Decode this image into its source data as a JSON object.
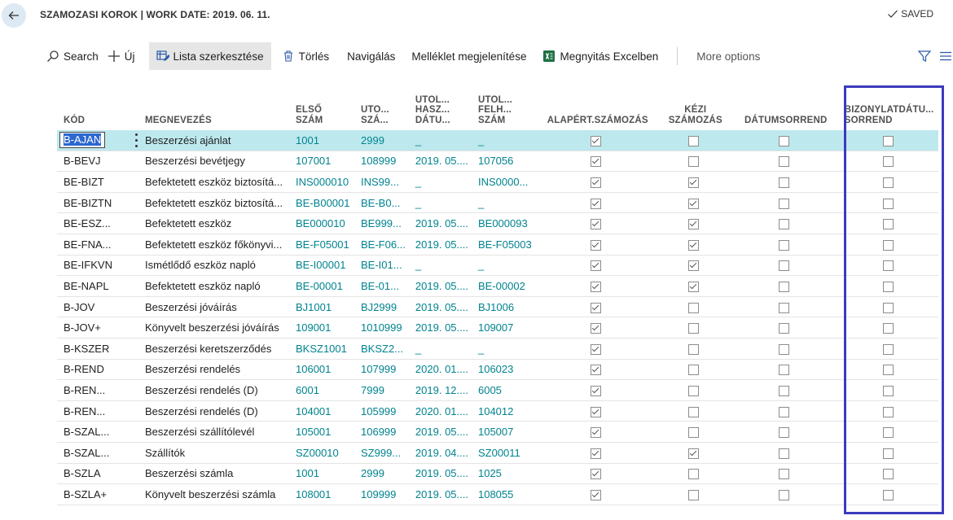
{
  "header": {
    "title": "SZAMOZASI KOROK | WORK DATE: 2019. 06. 11.",
    "saved_label": "SAVED"
  },
  "toolbar": {
    "search": "Search",
    "new": "Új",
    "edit_list": "Lista szerkesztése",
    "delete": "Törlés",
    "navigate": "Navigálás",
    "attachments": "Melléklet megjelenítése",
    "open_excel": "Megnyitás Excelben",
    "more_options": "More options"
  },
  "columns": [
    "KÓD",
    "MEGNEVEZÉS",
    "ELSŐ\nSZÁM",
    "UTO...\nSZÁ...",
    "UTOL...\nHASZ...\nDÁTU...",
    "UTOL...\nFELH...\nSZÁM",
    "ALAPÉRT.SZÁMOZÁS",
    "KÉZI\nSZÁMOZÁS",
    "DÁTUMSORREND",
    "BIZONYLATDÁTU...\nSORREND"
  ],
  "rows": [
    {
      "code": "B-AJAN",
      "name": "Beszerzési ajánlat",
      "first": "1001",
      "last": "2999",
      "date": "_",
      "lastused": "_",
      "def": true,
      "manual": false,
      "dateord": false,
      "docdate": false
    },
    {
      "code": "B-BEVJ",
      "name": "Beszerzési bevétjegy",
      "first": "107001",
      "last": "108999",
      "date": "2019. 05....",
      "lastused": "107056",
      "def": true,
      "manual": false,
      "dateord": false,
      "docdate": false
    },
    {
      "code": "BE-BIZT",
      "name": "Befektetett eszköz biztosítá...",
      "first": "INS000010",
      "last": "INS99...",
      "date": "_",
      "lastused": "INS0000...",
      "def": true,
      "manual": true,
      "dateord": false,
      "docdate": false
    },
    {
      "code": "BE-BIZTN",
      "name": "Befektetett eszköz biztosítá...",
      "first": "BE-B00001",
      "last": "BE-B0...",
      "date": "_",
      "lastused": "_",
      "def": true,
      "manual": true,
      "dateord": false,
      "docdate": false
    },
    {
      "code": "BE-ESZ...",
      "name": "Befektetett eszköz",
      "first": "BE000010",
      "last": "BE999...",
      "date": "2019. 05....",
      "lastused": "BE000093",
      "def": true,
      "manual": true,
      "dateord": false,
      "docdate": false
    },
    {
      "code": "BE-FNA...",
      "name": "Befektetett eszköz főkönyvi...",
      "first": "BE-F05001",
      "last": "BE-F06...",
      "date": "2019. 05....",
      "lastused": "BE-F05003",
      "def": true,
      "manual": true,
      "dateord": false,
      "docdate": false
    },
    {
      "code": "BE-IFKVN",
      "name": "Ismétlődő eszköz napló",
      "first": "BE-I00001",
      "last": "BE-I01...",
      "date": "_",
      "lastused": "_",
      "def": true,
      "manual": true,
      "dateord": false,
      "docdate": false
    },
    {
      "code": "BE-NAPL",
      "name": "Befektetett eszköz napló",
      "first": "BE-00001",
      "last": "BE-01...",
      "date": "2019. 05....",
      "lastused": "BE-00002",
      "def": true,
      "manual": true,
      "dateord": false,
      "docdate": false
    },
    {
      "code": "B-JOV",
      "name": "Beszerzési jóváírás",
      "first": "BJ1001",
      "last": "BJ2999",
      "date": "2019. 05....",
      "lastused": "BJ1006",
      "def": true,
      "manual": false,
      "dateord": false,
      "docdate": false
    },
    {
      "code": "B-JOV+",
      "name": "Könyvelt beszerzési jóváírás",
      "first": "109001",
      "last": "1010999",
      "date": "2019. 05....",
      "lastused": "109007",
      "def": true,
      "manual": false,
      "dateord": false,
      "docdate": false
    },
    {
      "code": "B-KSZER",
      "name": "Beszerzési keretszerződés",
      "first": "BKSZ1001",
      "last": "BKSZ2...",
      "date": "_",
      "lastused": "_",
      "def": true,
      "manual": false,
      "dateord": false,
      "docdate": false
    },
    {
      "code": "B-REND",
      "name": "Beszerzési rendelés",
      "first": "106001",
      "last": "107999",
      "date": "2020. 01....",
      "lastused": "106023",
      "def": true,
      "manual": false,
      "dateord": false,
      "docdate": false
    },
    {
      "code": "B-REN...",
      "name": "Beszerzési rendelés (D)",
      "first": "6001",
      "last": "7999",
      "date": "2019. 12....",
      "lastused": "6005",
      "def": true,
      "manual": false,
      "dateord": false,
      "docdate": false
    },
    {
      "code": "B-REN...",
      "name": "Beszerzési rendelés (D)",
      "first": "104001",
      "last": "105999",
      "date": "2020. 01....",
      "lastused": "104012",
      "def": true,
      "manual": false,
      "dateord": false,
      "docdate": false
    },
    {
      "code": "B-SZAL...",
      "name": "Beszerzési szállítólevél",
      "first": "105001",
      "last": "106999",
      "date": "2019. 05....",
      "lastused": "105007",
      "def": true,
      "manual": false,
      "dateord": false,
      "docdate": false
    },
    {
      "code": "B-SZAL...",
      "name": "Szállítók",
      "first": "SZ00010",
      "last": "SZ999...",
      "date": "2019. 04....",
      "lastused": "SZ00011",
      "def": true,
      "manual": true,
      "dateord": false,
      "docdate": false
    },
    {
      "code": "B-SZLA",
      "name": "Beszerzési számla",
      "first": "1001",
      "last": "2999",
      "date": "2019. 05....",
      "lastused": "1025",
      "def": true,
      "manual": false,
      "dateord": false,
      "docdate": false
    },
    {
      "code": "B-SZLA+",
      "name": "Könyvelt beszerzési számla",
      "first": "108001",
      "last": "109999",
      "date": "2019. 05....",
      "lastused": "108055",
      "def": true,
      "manual": false,
      "dateord": false,
      "docdate": false
    }
  ],
  "selected_row": 0,
  "colors": {
    "accent": "#00838f",
    "selected_row": "#bde9ee",
    "highlight_frame": "#3b3bbd"
  }
}
